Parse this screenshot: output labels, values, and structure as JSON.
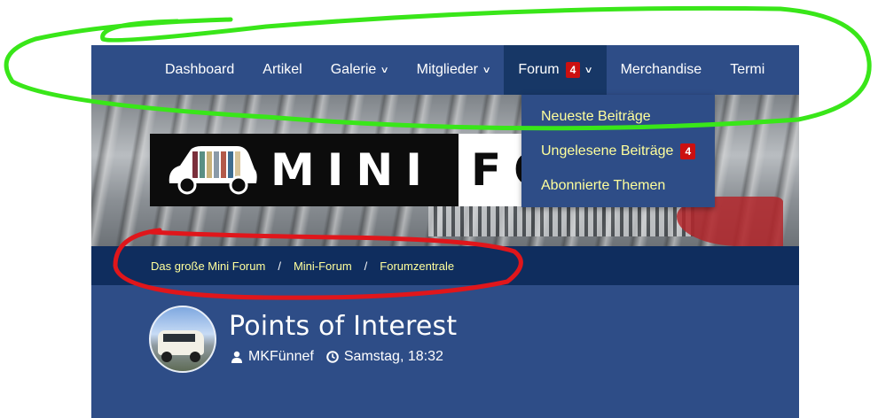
{
  "nav": {
    "items": [
      {
        "label": "Dashboard",
        "chevron": false
      },
      {
        "label": "Artikel",
        "chevron": false
      },
      {
        "label": "Galerie",
        "chevron": true
      },
      {
        "label": "Mitglieder",
        "chevron": true
      },
      {
        "label": "Forum",
        "chevron": true,
        "badge": "4",
        "active": true
      },
      {
        "label": "Merchandise",
        "chevron": false
      },
      {
        "label": "Termi",
        "chevron": false
      }
    ]
  },
  "dropdown": {
    "items": [
      {
        "label": "Neueste Beiträge"
      },
      {
        "label": "Ungelesene Beiträge",
        "badge": "4"
      },
      {
        "label": "Abonnierte Themen"
      }
    ]
  },
  "logo": {
    "word_left": "MINI",
    "word_right": "FO"
  },
  "breadcrumb": [
    "Das große Mini Forum",
    "Mini-Forum",
    "Forumzentrale"
  ],
  "thread": {
    "title": "Points of Interest",
    "author": "MKFünnef",
    "time": "Samstag, 18:32"
  },
  "colors": {
    "nav_bg": "#2e4d87",
    "nav_active": "#173766",
    "link_yellow": "#ffff9c",
    "badge_red": "#cc1010",
    "crumb_bar": "#0f2d5e",
    "annotation_green": "#39e619",
    "annotation_red": "#e0161b"
  }
}
